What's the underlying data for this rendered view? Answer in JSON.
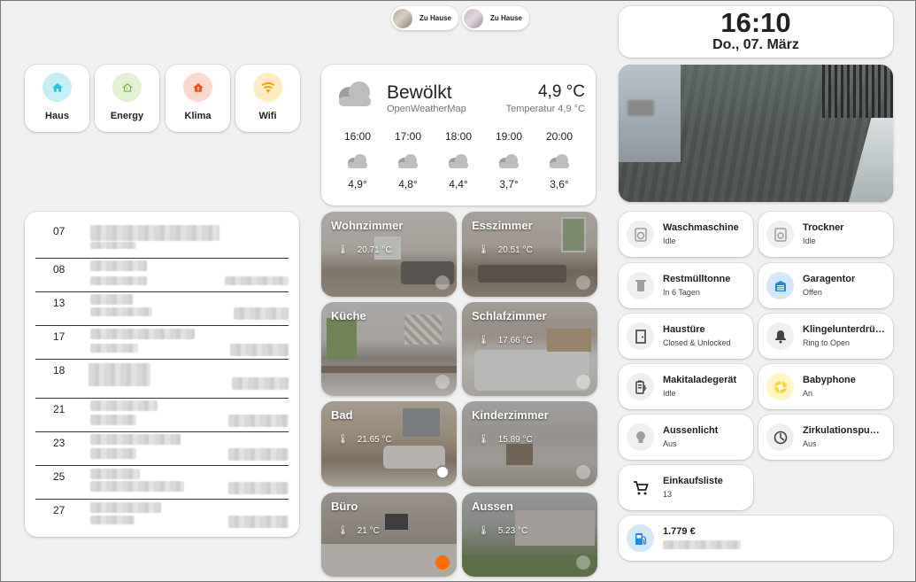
{
  "persons": [
    {
      "label": "Zu Hause"
    },
    {
      "label": "Zu Hause"
    }
  ],
  "clock": {
    "time": "16:10",
    "date": "Do., 07. März"
  },
  "nav": [
    {
      "label": "Haus",
      "icon": "home-icon",
      "color": "#26c6da"
    },
    {
      "label": "Energy",
      "icon": "energy-home-icon",
      "color": "#8bc34a"
    },
    {
      "label": "Klima",
      "icon": "thermostat-icon",
      "color": "#f4511e"
    },
    {
      "label": "Wifi",
      "icon": "wifi-icon",
      "color": "#ffb300"
    }
  ],
  "weather": {
    "condition": "Bewölkt",
    "source": "OpenWeatherMap",
    "temperature": "4,9 °C",
    "subtitle": "Temperatur 4,9 °C",
    "forecast": [
      {
        "time": "16:00",
        "temp": "4,9°"
      },
      {
        "time": "17:00",
        "temp": "4,8°"
      },
      {
        "time": "18:00",
        "temp": "4,4°"
      },
      {
        "time": "19:00",
        "temp": "3,7°"
      },
      {
        "time": "20:00",
        "temp": "3,6°"
      }
    ]
  },
  "calendar": [
    {
      "day": "07"
    },
    {
      "day": "08"
    },
    {
      "day": "13"
    },
    {
      "day": "17"
    },
    {
      "day": "18"
    },
    {
      "day": "21"
    },
    {
      "day": "23"
    },
    {
      "day": "25"
    },
    {
      "day": "27"
    }
  ],
  "rooms": [
    {
      "name": "Wohnzimmer",
      "temp": "20.71 °C"
    },
    {
      "name": "Esszimmer",
      "temp": "20.51 °C"
    },
    {
      "name": "Küche",
      "temp": ""
    },
    {
      "name": "Schlafzimmer",
      "temp": "17.66 °C"
    },
    {
      "name": "Bad",
      "temp": "21.65 °C"
    },
    {
      "name": "Kinderzimmer",
      "temp": "15.89 °C"
    },
    {
      "name": "Büro",
      "temp": "21 °C"
    },
    {
      "name": "Aussen",
      "temp": "5.23 °C"
    }
  ],
  "entities": [
    {
      "name": "Waschmaschine",
      "state": "Idle",
      "icon": "washing-machine-icon"
    },
    {
      "name": "Trockner",
      "state": "Idle",
      "icon": "tumble-dryer-icon"
    },
    {
      "name": "Restmülltonne",
      "state": "In 6 Tagen",
      "icon": "trash-can-icon"
    },
    {
      "name": "Garagentor",
      "state": "Offen",
      "icon": "garage-open-icon"
    },
    {
      "name": "Haustüre",
      "state": "Closed & Unlocked",
      "icon": "door-icon"
    },
    {
      "name": "Klingelunterdrückung",
      "state": "Ring to Open",
      "icon": "bell-off-icon"
    },
    {
      "name": "Makitaladegerät",
      "state": "Idle",
      "icon": "battery-charging-icon"
    },
    {
      "name": "Babyphone",
      "state": "An",
      "icon": "camera-iris-icon"
    },
    {
      "name": "Aussenlicht",
      "state": "Aus",
      "icon": "lightbulb-icon"
    },
    {
      "name": "Zirkulationspumpe",
      "state": "Aus",
      "icon": "pump-icon"
    },
    {
      "name": "Einkaufsliste",
      "state": "13",
      "icon": "cart-icon"
    }
  ],
  "fuel": {
    "price": "1.779 €",
    "icon": "gas-station-icon"
  },
  "colors": {
    "garage": "#1e88e5",
    "babyphone": "#fdd835",
    "fuel": "#1e88e5"
  }
}
